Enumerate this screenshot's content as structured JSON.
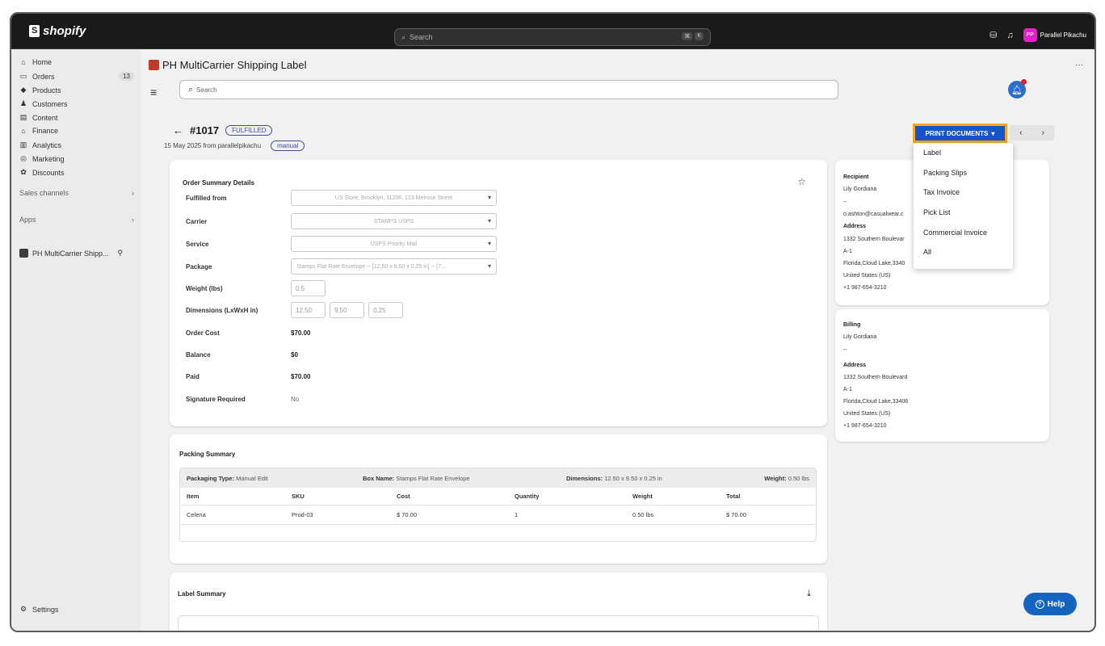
{
  "topbar": {
    "logo_text": "shopify",
    "search_placeholder": "Search",
    "shortcut_key1": "⌘",
    "shortcut_key2": "K",
    "avatar_initials": "PP",
    "user_name": "Parallel Pikachu",
    "avatar_color": "#e021c8"
  },
  "sidebar": {
    "items": [
      {
        "label": "Home",
        "icon": "home-icon"
      },
      {
        "label": "Orders",
        "icon": "inbox-icon",
        "badge": "13"
      },
      {
        "label": "Products",
        "icon": "tag-icon"
      },
      {
        "label": "Customers",
        "icon": "person-icon"
      },
      {
        "label": "Content",
        "icon": "content-icon"
      },
      {
        "label": "Finance",
        "icon": "bank-icon"
      },
      {
        "label": "Analytics",
        "icon": "bar-chart-icon"
      },
      {
        "label": "Marketing",
        "icon": "target-icon"
      },
      {
        "label": "Discounts",
        "icon": "discount-icon"
      }
    ],
    "sales_channels": "Sales channels",
    "apps": "Apps",
    "app_item": "PH MultiCarrier Shipp...",
    "settings": "Settings"
  },
  "app": {
    "title": "PH MultiCarrier Shipping Label",
    "search_placeholder": "Search",
    "order_number": "#1017",
    "order_status": "FULFILLED",
    "order_meta": "15 May 2025 from parallelpikachu",
    "order_tag": "manual",
    "print_button": "PRINT DOCUMENTS",
    "print_menu": [
      "Label",
      "Packing Slips",
      "Tax Invoice",
      "Pick List",
      "Commercial Invoice",
      "All"
    ]
  },
  "order_summary": {
    "title": "Order Summary Details",
    "fulfilled_from_label": "Fulfilled from",
    "fulfilled_from_value": "US Store, Brooklyn, 11206, 123 Melrose Street",
    "carrier_label": "Carrier",
    "carrier_value": "STAMPS USPS",
    "service_label": "Service",
    "service_value": "USPS Priority Mail",
    "package_label": "Package",
    "package_value": "Stamps Flat Rate Envelope -- [12.50 x 9.50 x 0.25 in] -- [7...",
    "weight_label": "Weight (lbs)",
    "weight_value": "0.5",
    "dimensions_label": "Dimensions (LxWxH in)",
    "dim_l": "12.50",
    "dim_w": "9.50",
    "dim_h": "0.25",
    "order_cost_label": "Order Cost",
    "order_cost_value": "$70.00",
    "balance_label": "Balance",
    "balance_value": "$0",
    "paid_label": "Paid",
    "paid_value": "$70.00",
    "signature_label": "Signature Required",
    "signature_value": "No"
  },
  "packing_summary": {
    "title": "Packing Summary",
    "packaging_type_label": "Packaging Type:",
    "packaging_type_value": "Manual Edit",
    "box_name_label": "Box Name:",
    "box_name_value": "Stamps Flat Rate Envelope",
    "dimensions_label": "Dimensions:",
    "dimensions_value": "12.50 x 9.50 x 0.25 in",
    "weight_label": "Weight:",
    "weight_value": "0.50 lbs",
    "columns": [
      "Item",
      "SKU",
      "Cost",
      "Quantity",
      "Weight",
      "Total"
    ],
    "rows": [
      [
        "Celena",
        "Prod-03",
        "$ 70.00",
        "1",
        "0.50 lbs",
        "$ 70.00"
      ]
    ]
  },
  "label_summary": {
    "title": "Label Summary"
  },
  "recipient": {
    "title": "Recipient",
    "name": "Lily Gordiana",
    "dash": "--",
    "email": "o.ashton@casualwear.c",
    "address_label": "Address",
    "line1": "1332 Southern Boulevar",
    "line2": "A-1",
    "line3": "Florida,Cloud Lake,3340",
    "country": "United States (US)",
    "phone": "+1 987-654-3210"
  },
  "billing": {
    "title": "Billing",
    "name": "Lily Gordiana",
    "dash": "--",
    "address_label": "Address",
    "line1": "1332 Southern Boulevard",
    "line2": "A-1",
    "line3": "Florida,Cloud Lake,33406",
    "country": "United States (US)",
    "phone": "+1 987-654-3210"
  },
  "help": {
    "label": "Help"
  }
}
